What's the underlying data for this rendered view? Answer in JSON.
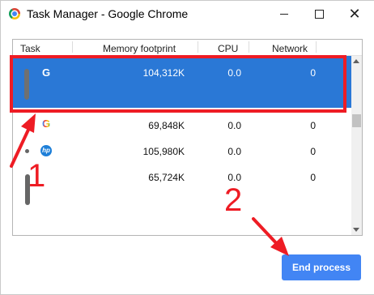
{
  "window": {
    "title": "Task Manager - Google Chrome",
    "controls": {
      "minimize": "–",
      "maximize": "□",
      "close": "✕"
    }
  },
  "table": {
    "columns": [
      "Task",
      "Memory footprint",
      "CPU",
      "Network"
    ],
    "rows": [
      {
        "icon": "google-g-icon",
        "memory": "104,312K",
        "cpu": "0.0",
        "network": "0",
        "selected": true
      },
      {
        "icon": "google-g-icon",
        "memory": "69,848K",
        "cpu": "0.0",
        "network": "0",
        "selected": false
      },
      {
        "icon": "hp-icon",
        "memory": "105,980K",
        "cpu": "0.0",
        "network": "0",
        "selected": false
      },
      {
        "icon": "none",
        "memory": "65,724K",
        "cpu": "0.0",
        "network": "0",
        "selected": false
      }
    ]
  },
  "buttons": {
    "end_process": "End process"
  },
  "annotations": {
    "step1": "1",
    "step2": "2"
  },
  "colors": {
    "selection": "#2a78d6",
    "button": "#4285f4",
    "annotation": "#ee1c24"
  }
}
